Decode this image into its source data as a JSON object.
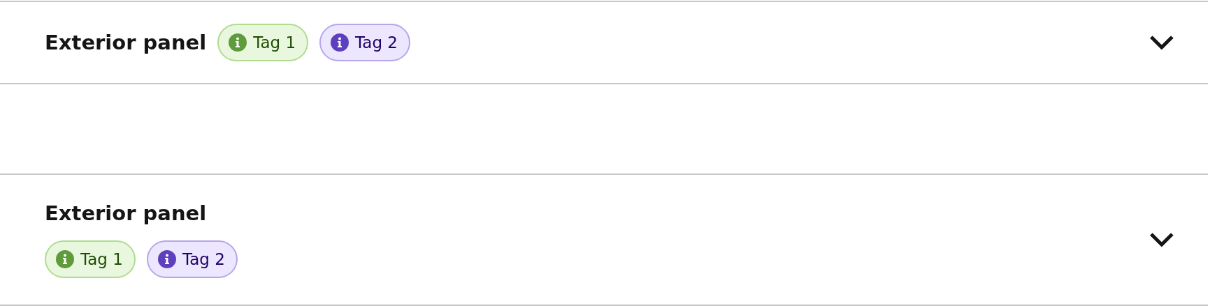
{
  "panels": [
    {
      "title": "Exterior panel",
      "kind": "inline",
      "expanded": false,
      "tags": [
        {
          "label": "Tag 1",
          "color": "#5e9b3b"
        },
        {
          "label": "Tag 2",
          "color": "#5e40be"
        }
      ]
    },
    {
      "title": "Exterior panel",
      "kind": "stacked",
      "expanded": false,
      "tags": [
        {
          "label": "Tag 1",
          "color": "#5e9b3b"
        },
        {
          "label": "Tag 2",
          "color": "#5e40be"
        }
      ]
    }
  ]
}
